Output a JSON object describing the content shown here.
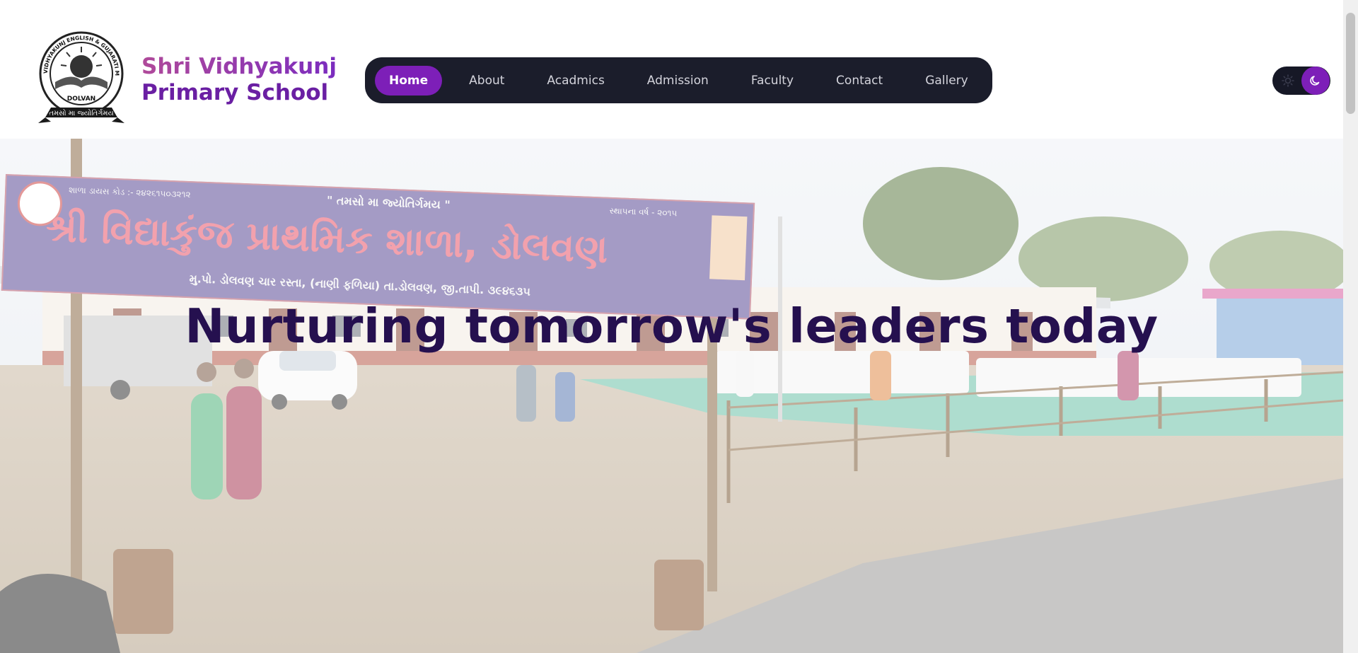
{
  "brand": {
    "line1": "Shri Vidhyakunj",
    "line2": "Primary School",
    "logo_text_ring": "VIDHYAKUNJ ENGLISH & GUJARATI MEDIUM SCHOOL",
    "logo_text_center": "DOLVAN",
    "logo_text_ribbon": "તમસો મા જ્યોતિર્ગમય"
  },
  "nav": {
    "items": [
      {
        "label": "Home",
        "active": true
      },
      {
        "label": "About",
        "active": false
      },
      {
        "label": "Acadmics",
        "active": false
      },
      {
        "label": "Admission",
        "active": false
      },
      {
        "label": "Faculty",
        "active": false
      },
      {
        "label": "Contact",
        "active": false
      },
      {
        "label": "Gallery",
        "active": false
      }
    ]
  },
  "theme_toggle": {
    "options": [
      "sun-icon",
      "moon-icon"
    ],
    "selected": "moon-icon"
  },
  "hero": {
    "title": "Nurturing tomorrow's leaders today",
    "banner": {
      "top_left": "શાળા ડાયસ કોડ :- ૨૪૨૬૧૫૦૩૨૧૨",
      "motto": "\" તમસો મા જ્યોતિર્ગમય \"",
      "top_right": "સ્થાપના વર્ષ - ૨૦૧૫",
      "main": "શ્રી વિદ્યાકુંજ પ્રાથમિક શાળા, ડોલવણ",
      "address": "મુ.પો. ડોલવણ ચાર રસ્તા, (નાણી ફળિયા) તા.ડોલવણ, જી.તાપી. ૩૯૪૬૩૫"
    }
  },
  "colors": {
    "accent": "#7d1fb8",
    "nav_bg": "#1b1d2b",
    "title": "#25104f",
    "brand_start": "#b04a9a",
    "brand_end": "#6a1fa3"
  }
}
